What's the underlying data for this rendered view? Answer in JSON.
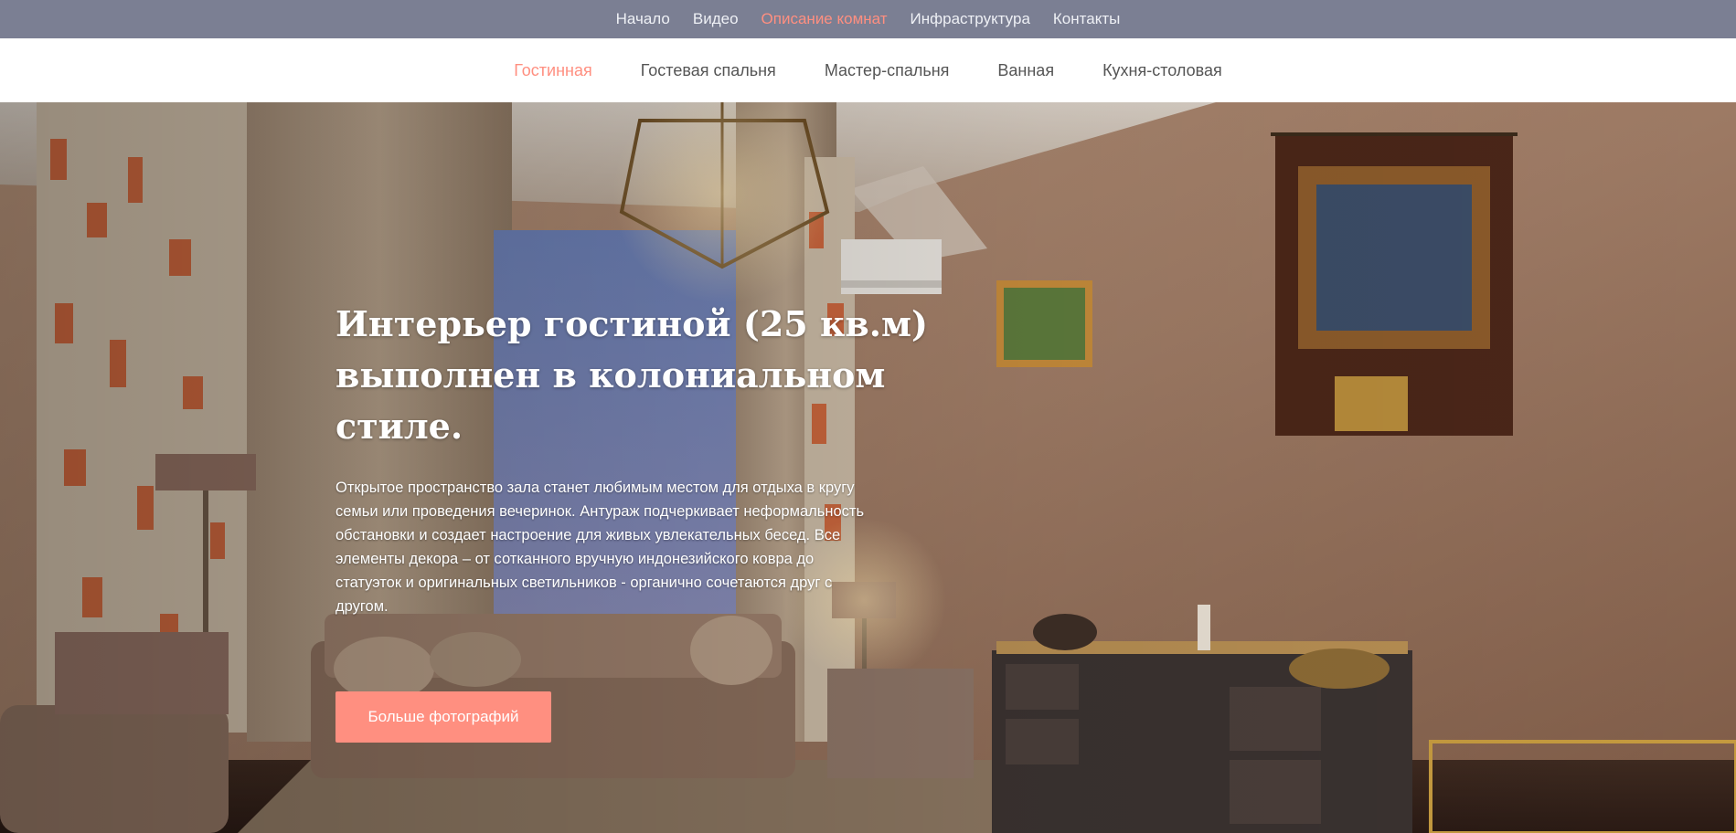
{
  "top_nav": {
    "items": [
      {
        "label": "Начало"
      },
      {
        "label": "Видео"
      },
      {
        "label": "Описание комнат"
      },
      {
        "label": "Инфраструктура"
      },
      {
        "label": "Контакты"
      }
    ],
    "active": "Описание комнат"
  },
  "room_nav": {
    "items": [
      {
        "label": "Гостинная"
      },
      {
        "label": "Гостевая спальня"
      },
      {
        "label": "Мастер-спальня"
      },
      {
        "label": "Ванная"
      },
      {
        "label": "Кухня-столовая"
      }
    ],
    "active": "Гостинная"
  },
  "hero": {
    "title": "Интерьер гостиной (25 кв.м) выполнен в колониальном стиле.",
    "text": "Открытое пространство зала станет любимым местом для отдыха в кругу семьи или проведения вечеринок. Антураж подчеркивает неформальность обстановки и создает настроение для живых увлекательных бесед. Все элементы декора – от сотканного вручную индонезийского ковра до статуэток и оригинальных светильников - органично сочетаются друг с другом.",
    "button_label": "Больше фотографий"
  },
  "colors": {
    "top_bar_bg": "#7b7f93",
    "accent": "#ff8f80",
    "sub_nav_text": "#555555"
  }
}
